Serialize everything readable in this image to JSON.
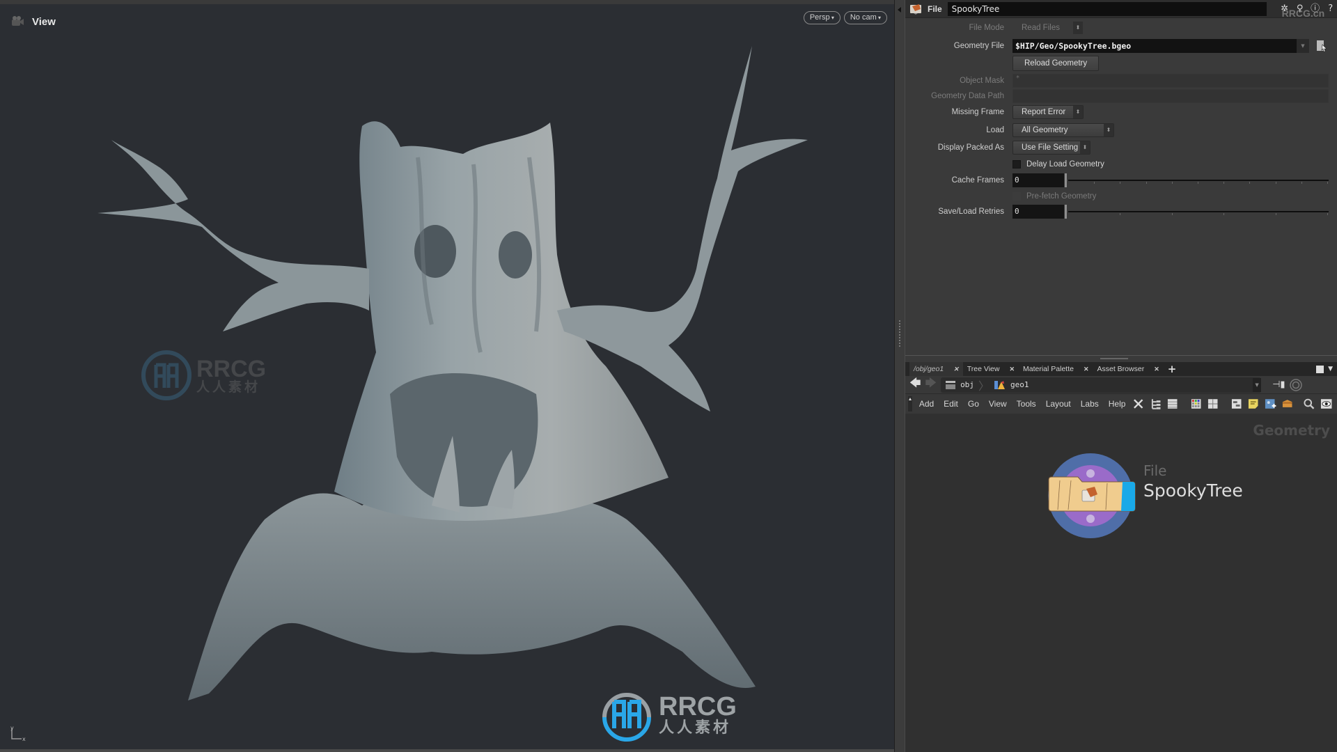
{
  "viewport": {
    "title": "View",
    "camera_mode": "Persp",
    "camera_select": "No cam",
    "axis_labels": {
      "y": "y",
      "x": "x"
    },
    "watermark": {
      "brand": "RRCG",
      "sub": "人人素材"
    }
  },
  "params": {
    "node_type": "File",
    "node_name": "SpookyTree",
    "header_icons": [
      "gear-icon",
      "search-icon",
      "info-icon",
      "help-icon"
    ],
    "header_watermark": "RRCG.cn",
    "file_mode": {
      "label": "File Mode",
      "value": "Read Files"
    },
    "geometry_file": {
      "label": "Geometry File",
      "value": "$HIP/Geo/SpookyTree.bgeo"
    },
    "reload_button": "Reload Geometry",
    "object_mask": {
      "label": "Object Mask",
      "value": "*"
    },
    "geometry_data_path": {
      "label": "Geometry Data Path",
      "value": ""
    },
    "missing_frame": {
      "label": "Missing Frame",
      "value": "Report Error"
    },
    "load": {
      "label": "Load",
      "value": "All Geometry"
    },
    "display_packed_as": {
      "label": "Display Packed As",
      "value": "Use File Setting"
    },
    "delay_load": {
      "label": "Delay Load Geometry",
      "checked": false
    },
    "cache_frames": {
      "label": "Cache Frames",
      "value": "0"
    },
    "prefetch": {
      "label": "Pre-fetch Geometry",
      "checked": false,
      "enabled": false
    },
    "save_load_retries": {
      "label": "Save/Load Retries",
      "value": "0"
    }
  },
  "network": {
    "tabs": [
      {
        "label": "/obj/geo1",
        "active": true
      },
      {
        "label": "Tree View"
      },
      {
        "label": "Material Palette"
      },
      {
        "label": "Asset Browser"
      }
    ],
    "path": [
      "obj",
      "geo1"
    ],
    "menu": [
      "Add",
      "Edit",
      "Go",
      "View",
      "Tools",
      "Layout",
      "Labs",
      "Help"
    ],
    "context_label": "Geometry",
    "node": {
      "type": "File",
      "name": "SpookyTree"
    }
  },
  "colors": {
    "viewport_bg": "#2b2e33",
    "pane_bg": "#3a3a3a",
    "network_bg": "#303030",
    "node_ring_outer": "#4f6ea8",
    "node_ring_inner": "#9a6bc9",
    "node_body": "#f0cc8e",
    "node_display_flag": "#19a9e8",
    "watermark_blue": "#2aa7e8"
  }
}
